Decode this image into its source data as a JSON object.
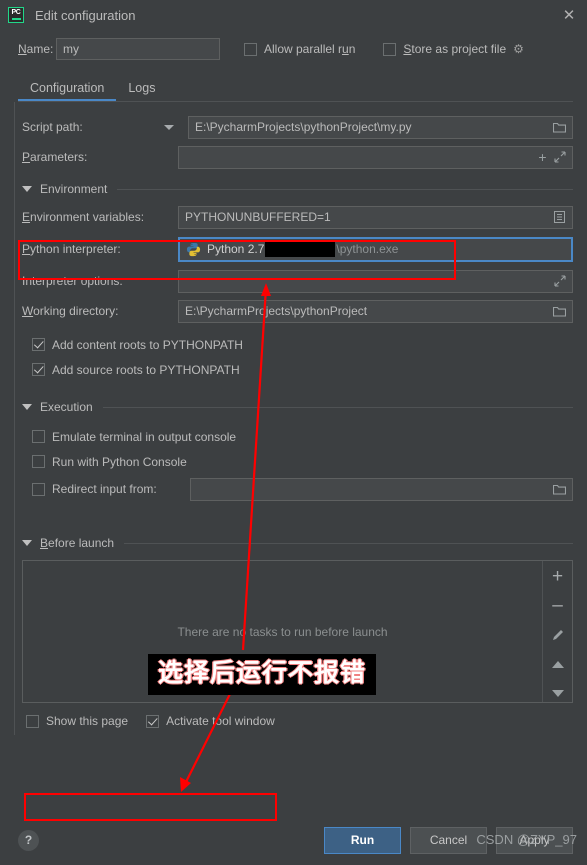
{
  "window": {
    "app_icon": "pycharm-icon",
    "app_icon_text": "PC",
    "title": "Edit configuration",
    "close_icon": "close-icon"
  },
  "name_row": {
    "label": "Name:",
    "label_mnemonic": "N",
    "value": "my",
    "placeholder": "",
    "allow_parallel_run": {
      "label": "Allow parallel run",
      "checked": false
    },
    "store_as_project_file": {
      "label": "Store as project file",
      "checked": false
    },
    "gear_icon": "gear-icon"
  },
  "tabs": [
    {
      "label": "Configuration",
      "active": true
    },
    {
      "label": "Logs",
      "active": false
    }
  ],
  "form": {
    "script_path": {
      "label": "Script path:",
      "value": "E:\\PycharmProjects\\pythonProject\\my.py",
      "dropdown_icon": "chevron-down-icon",
      "browse_icon": "folder-icon"
    },
    "parameters": {
      "label": "Parameters:",
      "label_mnemonic": "P",
      "value": "",
      "insert_icon": "plus-icon",
      "expand_icon": "expand-icon"
    },
    "environment_section": {
      "title": "Environment",
      "collapse_icon": "triangle-down-icon"
    },
    "environment_variables": {
      "label": "Environment variables:",
      "label_mnemonic": "E",
      "value": "PYTHONUNBUFFERED=1",
      "edit_icon": "list-edit-icon"
    },
    "python_interpreter": {
      "label": "Python interpreter:",
      "label_mnemonic": "P",
      "value_prefix": "Python 2.7",
      "value_suffix": "\\python.exe",
      "redacted": true,
      "icon": "python-icon",
      "dropdown_icon": "chevron-down-icon",
      "focused": true
    },
    "interpreter_options": {
      "label": "Interpreter options:",
      "value": "",
      "expand_icon": "expand-icon"
    },
    "working_directory": {
      "label": "Working directory:",
      "label_mnemonic": "W",
      "value": "E:\\PycharmProjects\\pythonProject",
      "browse_icon": "folder-icon"
    },
    "add_content_roots": {
      "label": "Add content roots to PYTHONPATH",
      "checked": true
    },
    "add_source_roots": {
      "label": "Add source roots to PYTHONPATH",
      "checked": true
    },
    "execution_section": {
      "title": "Execution",
      "collapse_icon": "triangle-down-icon"
    },
    "emulate_terminal": {
      "label": "Emulate terminal in output console",
      "checked": false
    },
    "run_with_console": {
      "label": "Run with Python Console",
      "checked": false
    },
    "redirect_input": {
      "label": "Redirect input from:",
      "checked": false,
      "value": "",
      "browse_icon": "folder-icon"
    }
  },
  "before_launch": {
    "title": "Before launch",
    "title_mnemonic": "B",
    "collapse_icon": "triangle-down-icon",
    "empty_text": "There are no tasks to run before launch",
    "toolbar": [
      {
        "name": "add-task-button",
        "icon": "plus-icon",
        "glyph": "+"
      },
      {
        "name": "remove-task-button",
        "icon": "minus-icon",
        "glyph": "–"
      },
      {
        "name": "edit-task-button",
        "icon": "pencil-icon",
        "glyph": ""
      },
      {
        "name": "move-up-button",
        "icon": "arrow-up-icon",
        "glyph": ""
      },
      {
        "name": "move-down-button",
        "icon": "arrow-down-icon",
        "glyph": ""
      }
    ],
    "show_this_page": {
      "label": "Show this page",
      "checked": false
    },
    "activate_tool_window": {
      "label": "Activate tool window",
      "checked": true
    }
  },
  "footer": {
    "help_icon": "help-icon",
    "help_glyph": "?",
    "run_button": "Run",
    "cancel_button": "Cancel",
    "apply_button": "Apply"
  },
  "annotations": {
    "note_text": "选择后运行不报错",
    "highlight_color": "#ff0000",
    "note_bg": "#000000",
    "note_color": "#ffffff",
    "note_outline": "#f08080"
  },
  "watermark": {
    "text": "CSDN @ZYP_97"
  },
  "colors": {
    "dialog_bg": "#3c3f41",
    "input_bg": "#45484a",
    "accent_blue": "#4a88c7",
    "primary_button": "#3d6185",
    "text": "#bbbbbb",
    "logo_green": "#21d789"
  }
}
